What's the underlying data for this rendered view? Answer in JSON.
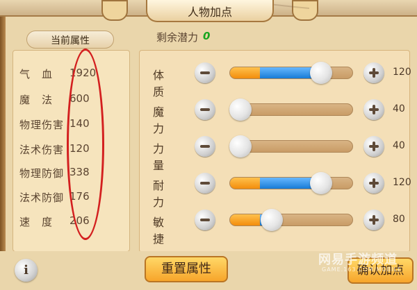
{
  "header": {
    "title": "人物加点"
  },
  "current_attributes": {
    "title": "当前属性",
    "stats": [
      {
        "label": "气　血",
        "value": "1920"
      },
      {
        "label": "魔　法",
        "value": "600"
      },
      {
        "label": "物理伤害",
        "value": "140"
      },
      {
        "label": "法术伤害",
        "value": "120"
      },
      {
        "label": "物理防御",
        "value": "338"
      },
      {
        "label": "法术防御",
        "value": "176"
      },
      {
        "label": "速　度",
        "value": "206"
      }
    ]
  },
  "potential": {
    "label": "剩余潜力",
    "value": "0"
  },
  "attributes": [
    {
      "label": "体质",
      "value": "120",
      "orange": 0.24,
      "blue": 0.5
    },
    {
      "label": "魔力",
      "value": "40",
      "orange": 0.0,
      "blue": 0.0
    },
    {
      "label": "力量",
      "value": "40",
      "orange": 0.0,
      "blue": 0.0
    },
    {
      "label": "耐力",
      "value": "120",
      "orange": 0.24,
      "blue": 0.5
    },
    {
      "label": "敏捷",
      "value": "80",
      "orange": 0.24,
      "blue": 0.1
    }
  ],
  "buttons": {
    "info": "i",
    "reset": "重置属性",
    "confirm": "确认加点"
  },
  "watermark": {
    "main": "网易手游频道",
    "sub": "GAME.163.COM/MOBILE"
  },
  "colors": {
    "orange": "#f79b17",
    "blue": "#2b8fe8",
    "potential_green": "#18a51f",
    "annotation_red": "#d31f1f"
  }
}
